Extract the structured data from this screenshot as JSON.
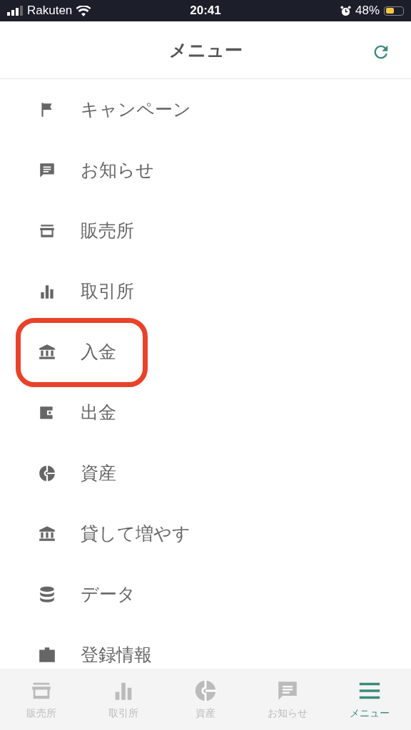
{
  "status_bar": {
    "carrier": "Rakuten",
    "time": "20:41",
    "battery": "48%"
  },
  "header": {
    "title": "メニュー"
  },
  "menu": [
    {
      "label": "キャンペーン",
      "highlighted": false
    },
    {
      "label": "お知らせ",
      "highlighted": false
    },
    {
      "label": "販売所",
      "highlighted": false
    },
    {
      "label": "取引所",
      "highlighted": false
    },
    {
      "label": "入金",
      "highlighted": true
    },
    {
      "label": "出金",
      "highlighted": false
    },
    {
      "label": "資産",
      "highlighted": false
    },
    {
      "label": "貸して増やす",
      "highlighted": false
    },
    {
      "label": "データ",
      "highlighted": false
    },
    {
      "label": "登録情報",
      "highlighted": false
    }
  ],
  "tab_bar": [
    {
      "label": "販売所",
      "selected": false
    },
    {
      "label": "取引所",
      "selected": false
    },
    {
      "label": "資産",
      "selected": false
    },
    {
      "label": "お知らせ",
      "selected": false
    },
    {
      "label": "メニュー",
      "selected": true
    }
  ]
}
